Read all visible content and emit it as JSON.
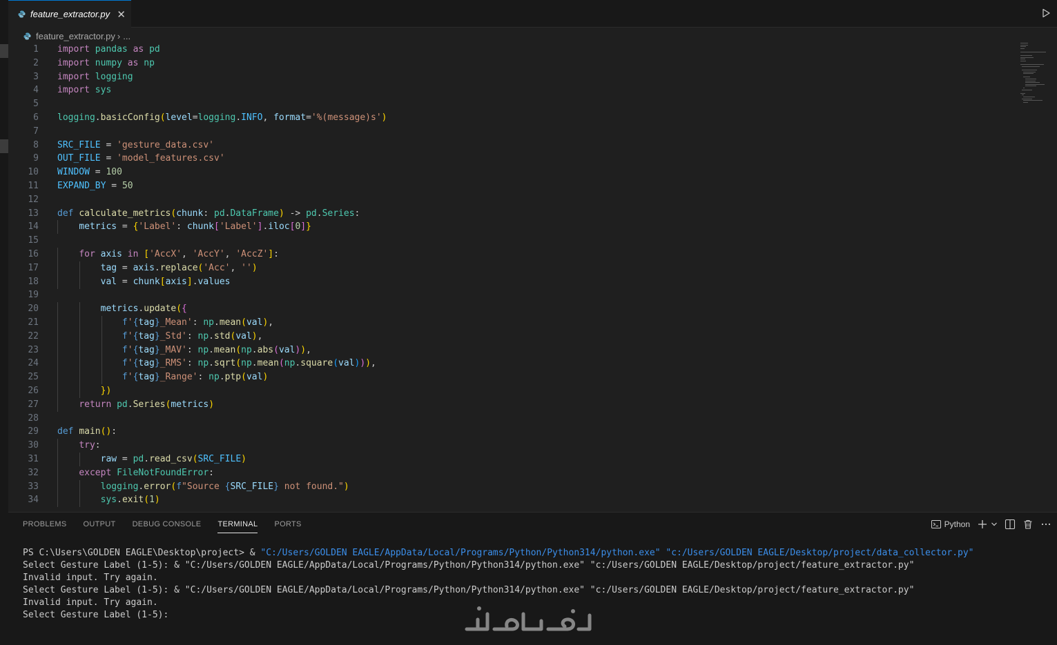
{
  "tab": {
    "filename": "feature_extractor.py",
    "close": "✕"
  },
  "breadcrumb": {
    "file": "feature_extractor.py",
    "sep": "›",
    "more": "..."
  },
  "editor": {
    "language": "Python",
    "lines": [
      "import pandas as pd",
      "import numpy as np",
      "import logging",
      "import sys",
      "",
      "logging.basicConfig(level=logging.INFO, format='%(message)s')",
      "",
      "SRC_FILE = 'gesture_data.csv'",
      "OUT_FILE = 'model_features.csv'",
      "WINDOW = 100",
      "EXPAND_BY = 50",
      "",
      "def calculate_metrics(chunk: pd.DataFrame) -> pd.Series:",
      "    metrics = {'Label': chunk['Label'].iloc[0]}",
      "",
      "    for axis in ['AccX', 'AccY', 'AccZ']:",
      "        tag = axis.replace('Acc', '')",
      "        val = chunk[axis].values",
      "",
      "        metrics.update({",
      "            f'{tag}_Mean': np.mean(val),",
      "            f'{tag}_Std': np.std(val),",
      "            f'{tag}_MAV': np.mean(np.abs(val)),",
      "            f'{tag}_RMS': np.sqrt(np.mean(np.square(val))),",
      "            f'{tag}_Range': np.ptp(val)",
      "        })",
      "    return pd.Series(metrics)",
      "",
      "def main():",
      "    try:",
      "        raw = pd.read_csv(SRC_FILE)",
      "    except FileNotFoundError:",
      "        logging.error(f\"Source {SRC_FILE} not found.\")",
      "        sys.exit(1)"
    ]
  },
  "panel": {
    "tabs": [
      "PROBLEMS",
      "OUTPUT",
      "DEBUG CONSOLE",
      "TERMINAL",
      "PORTS"
    ],
    "active_tab": "TERMINAL",
    "shell_label": "Python",
    "terminal_lines": [
      {
        "prefix": "PS C:\\Users\\GOLDEN EAGLE\\Desktop\\project> & ",
        "highlight": "\"C:/Users/GOLDEN EAGLE/AppData/Local/Programs/Python/Python314/python.exe\" \"c:/Users/GOLDEN EAGLE/Desktop/project/data_collector.py\""
      },
      {
        "prefix": "Select Gesture Label (1-5): & \"C:/Users/GOLDEN EAGLE/AppData/Local/Programs/Python/Python314/python.exe\" \"c:/Users/GOLDEN EAGLE/Desktop/project/feature_extractor.py\"",
        "highlight": ""
      },
      {
        "prefix": "Invalid input. Try again.",
        "highlight": ""
      },
      {
        "prefix": "Select Gesture Label (1-5): & \"C:/Users/GOLDEN EAGLE/AppData/Local/Programs/Python/Python314/python.exe\" \"c:/Users/GOLDEN EAGLE/Desktop/project/feature_extractor.py\"",
        "highlight": ""
      },
      {
        "prefix": "Invalid input. Try again.",
        "highlight": ""
      },
      {
        "prefix": "Select Gesture Label (1-5):",
        "highlight": ""
      }
    ]
  },
  "colors": {
    "accent": "#0078d4",
    "keyword": "#c586c0",
    "storage": "#569cd6",
    "function": "#dcdcaa",
    "variable": "#9cdcfe",
    "class": "#4ec9b0",
    "string": "#ce9178",
    "number": "#b5cea8",
    "constant": "#4fc1ff",
    "terminal_string": "#3b8eea"
  },
  "icons": [
    "python-file-icon",
    "close-icon",
    "run-icon",
    "terminal-icon",
    "plus-icon",
    "chevron-down-icon",
    "split-icon",
    "trash-icon",
    "more-icon"
  ]
}
